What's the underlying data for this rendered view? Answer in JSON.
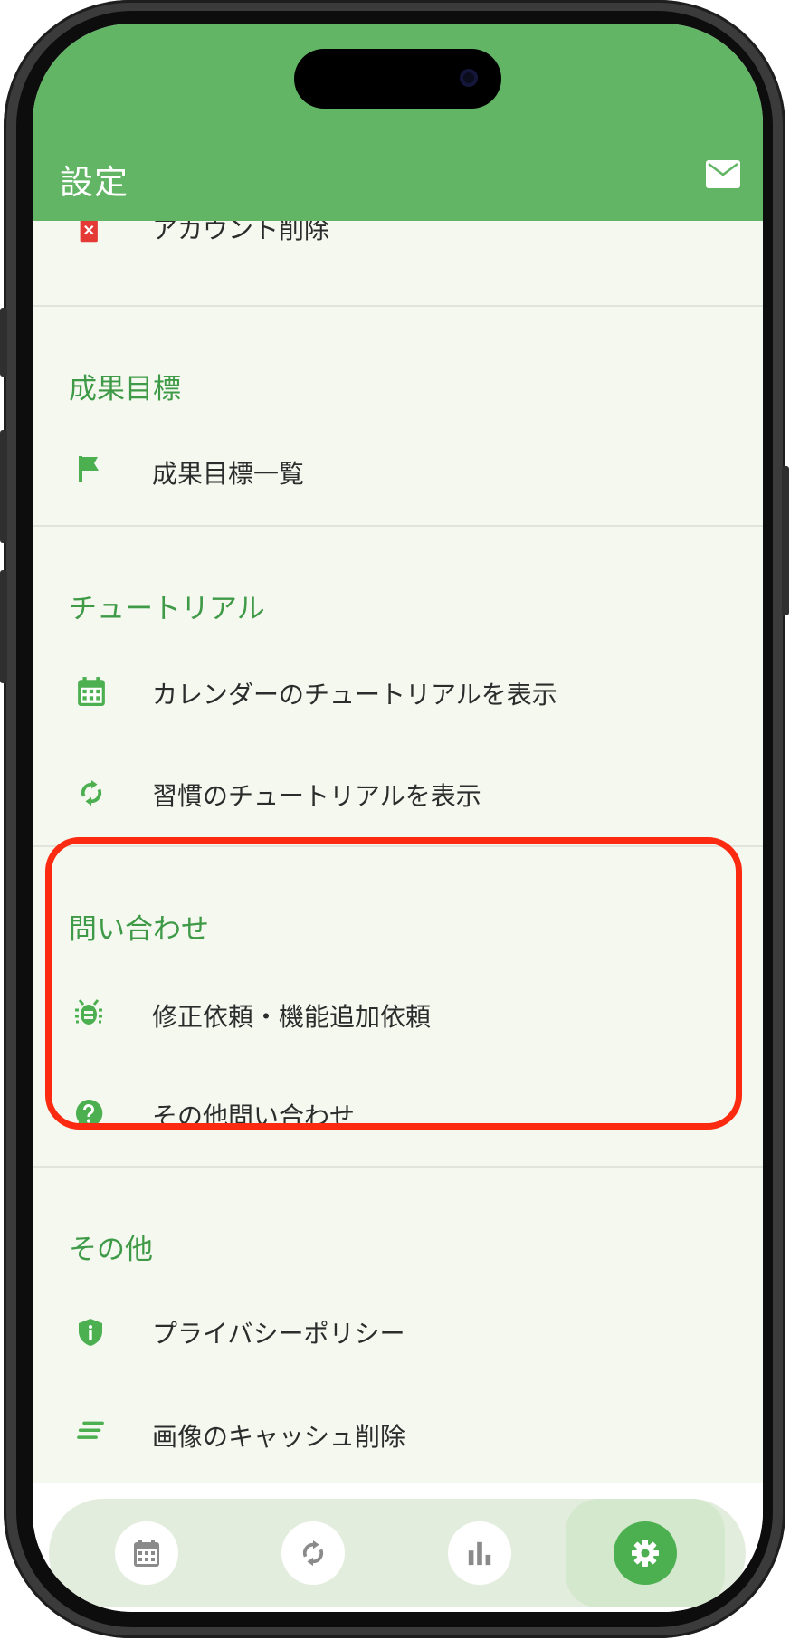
{
  "header": {
    "title": "設定",
    "mail_icon": "mail-icon"
  },
  "account": {
    "delete_label": "アカウント削除"
  },
  "sections": {
    "goals": {
      "title": "成果目標",
      "items": [
        "成果目標一覧"
      ]
    },
    "tutorial": {
      "title": "チュートリアル",
      "items": [
        "カレンダーのチュートリアルを表示",
        "習慣のチュートリアルを表示"
      ]
    },
    "contact": {
      "title": "問い合わせ",
      "items": [
        "修正依頼・機能追加依頼",
        "その他問い合わせ"
      ]
    },
    "other": {
      "title": "その他",
      "items": [
        "プライバシーポリシー",
        "画像のキャッシュ削除"
      ]
    }
  },
  "nav": {
    "items": [
      {
        "icon": "calendar-icon",
        "active": false
      },
      {
        "icon": "sync-icon",
        "active": false
      },
      {
        "icon": "bar-chart-icon",
        "active": false
      },
      {
        "icon": "gear-icon",
        "active": true
      }
    ]
  },
  "colors": {
    "brand": "#63b566",
    "accent": "#3f9a47",
    "highlight": "#fb2a10",
    "background": "#f4f8ef"
  }
}
